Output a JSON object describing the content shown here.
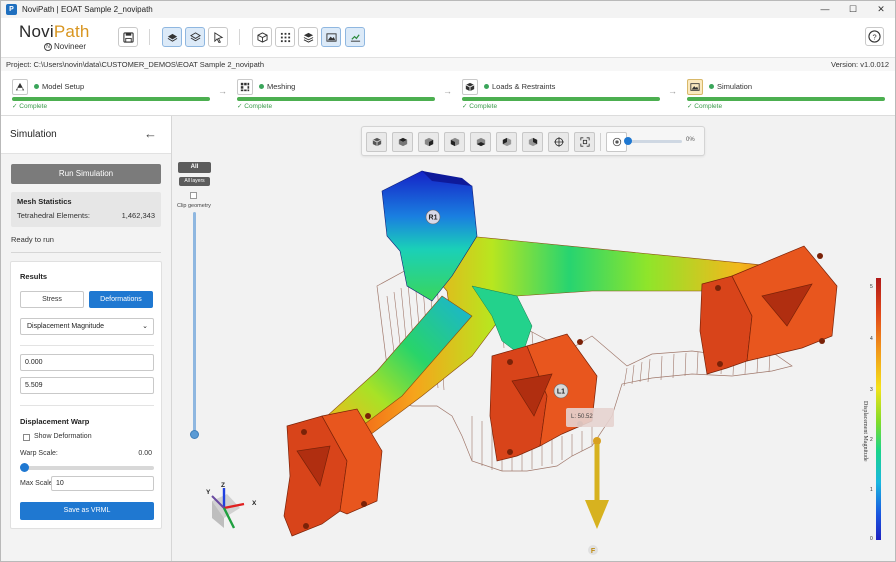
{
  "window": {
    "title": "NoviPath | EOAT Sample 2_novipath",
    "controls": {
      "minimize": "—",
      "maximize": "☐",
      "close": "✕"
    }
  },
  "logo": {
    "part1": "Novi",
    "part2": "Path",
    "sub": "Novineer"
  },
  "toolbar": {
    "icons": [
      "save-icon",
      "layer-single-icon",
      "layers-icon",
      "pointer-icon",
      "cube-icon",
      "grid-icon",
      "stack-icon",
      "image-icon",
      "chart-icon"
    ],
    "help": "?"
  },
  "project": {
    "path": "Project: C:\\Users\\novin\\data\\CUSTOMER_DEMOS\\EOAT Sample 2_novipath",
    "version": "Version: v1.0.012"
  },
  "workflow": {
    "steps": [
      {
        "label": "Model Setup",
        "status": "✓ Complete"
      },
      {
        "label": "Meshing",
        "status": "✓ Complete"
      },
      {
        "label": "Loads & Restraints",
        "status": "✓ Complete"
      },
      {
        "label": "Simulation",
        "status": "✓ Complete"
      }
    ],
    "arrow": "→",
    "accent": "#4caf50"
  },
  "sidebar": {
    "title": "Simulation",
    "back": "←",
    "run_button": "Run Simulation",
    "mesh": {
      "title": "Mesh Statistics",
      "key": "Tetrahedral Elements:",
      "value": "1,462,343"
    },
    "ready": "Ready to run",
    "results": {
      "title": "Results",
      "tabs": {
        "stress": "Stress",
        "deformations": "Deformations"
      },
      "select_value": "Displacement Magnitude",
      "min_value": "0.000",
      "max_value": "5.509",
      "warp": {
        "title": "Displacement Warp",
        "show_label": "Show Deformation",
        "scale_key": "Warp Scale:",
        "scale_val": "0.00",
        "scale_fraction": 0,
        "max_key": "Max Scale:",
        "max_val": "10"
      },
      "save_button": "Save as VRML"
    }
  },
  "viewport": {
    "opacity_val": "0%",
    "layers": {
      "all": "All",
      "all_layers": "All layers",
      "clip_label": "Clip geometry"
    },
    "legend": {
      "title": "Displacement Magnitude",
      "ticks": [
        "5",
        "4",
        "3",
        "2",
        "1",
        "0"
      ]
    },
    "labels": {
      "r1": "R1",
      "l1": "L1",
      "load_value": "L: 50.52",
      "force": "F"
    },
    "axes": {
      "x": "X",
      "y": "Y",
      "z": "Z"
    }
  }
}
